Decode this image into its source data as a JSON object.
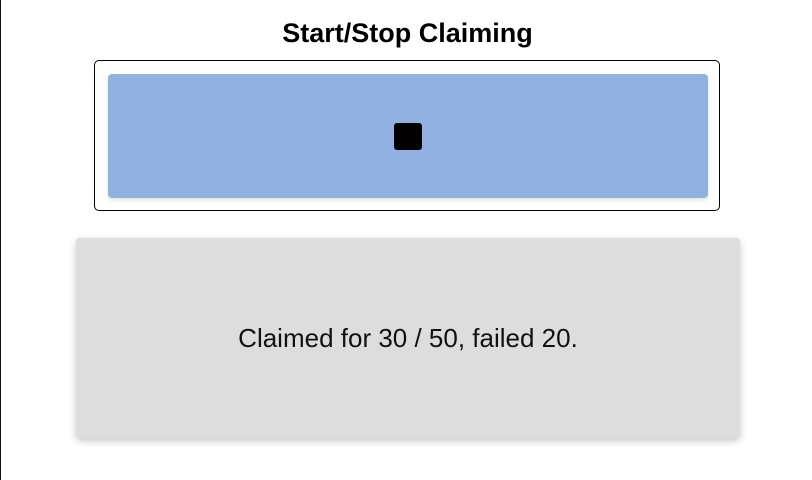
{
  "page": {
    "title": "Start/Stop Claiming"
  },
  "control": {
    "toggle_icon": "stop-icon",
    "state": "running"
  },
  "status": {
    "text": "Claimed for 30 / 50, failed 20."
  },
  "colors": {
    "button": "#91b2e1",
    "status_card": "#dddddd"
  }
}
